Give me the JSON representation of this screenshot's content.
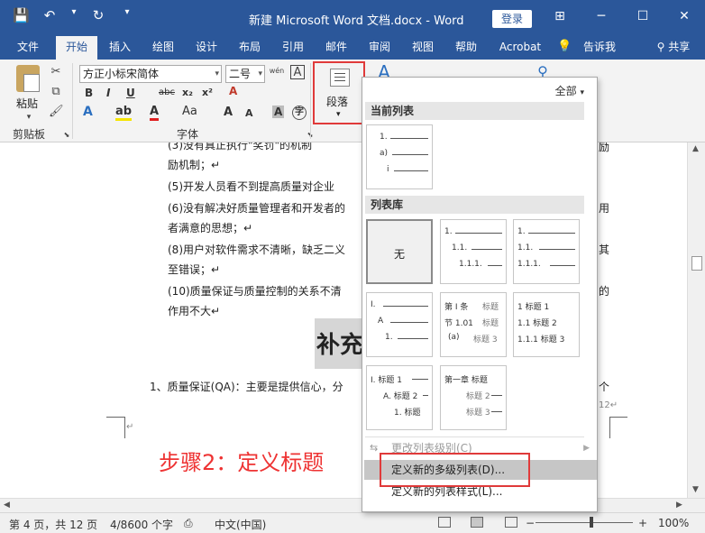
{
  "window": {
    "title": "新建 Microsoft Word 文档.docx - Word",
    "login": "登录",
    "qat": {
      "save": "💾",
      "undo": "↶",
      "undo_arrow": "▾",
      "redo": "↻",
      "customize": "▾"
    },
    "controls": {
      "ribbon_options": "⊞",
      "minimize": "─",
      "maximize": "☐",
      "close": "✕"
    }
  },
  "tabs": [
    "文件",
    "开始",
    "插入",
    "绘图",
    "设计",
    "布局",
    "引用",
    "邮件",
    "审阅",
    "视图",
    "帮助",
    "Acrobat",
    "告诉我",
    "共享"
  ],
  "active_tab": "开始",
  "tell_me_icon": "lightbulb-icon",
  "ribbon": {
    "clipboard": {
      "paste": "粘贴",
      "label": "剪贴板"
    },
    "font": {
      "family": "方正小标宋简体",
      "size": "二号",
      "label": "字体",
      "bold": "B",
      "italic": "I",
      "underline": "U",
      "strike": "abc",
      "sub": "x₂",
      "sup": "x²",
      "clear_format": "A",
      "grow": "A",
      "shrink": "A",
      "case": "Aa",
      "phonetic": "wén",
      "charborder": "A",
      "shading": "A"
    },
    "paragraph": {
      "label": "段落"
    }
  },
  "document": {
    "lines": [
      "(3)没有真正执行\"奖罚\"的机制",
      "励机制；↵",
      "(5)开发人员看不到提高质量对企业",
      "(6)没有解决好质量管理者和开发者的",
      "者满意的思想；↵",
      "(8)用户对软件需求不清晰，缺乏二义",
      "至错误；↵",
      "(10)质量保证与质量控制的关系不清",
      "作用不大↵"
    ],
    "right_fragments": [
      "励",
      "用",
      "其",
      "的"
    ],
    "heading": "补充",
    "qa_line": "1、质量保证(QA)：主要是提供信心，分",
    "qa_right": "个",
    "page_marker": "12↵",
    "step_note": "步骤2：定义标题"
  },
  "dropdown": {
    "filter": "全部",
    "current_section": "当前列表",
    "library_section": "列表库",
    "none_label": "无",
    "thumb_labels": {
      "current": [
        "1.",
        "a)",
        "i"
      ],
      "num_multi": [
        "1.",
        "1.1.",
        "1.1.1."
      ],
      "num_multi_dot": [
        "1.",
        "1.1.",
        "1.1.1."
      ],
      "roman": [
        "I.",
        "A",
        "1."
      ],
      "article": [
        "第 Ⅰ 条",
        "节 1.01",
        "(a)"
      ],
      "article_tags": [
        "标题",
        "标题",
        "标题 3"
      ],
      "heading_num": [
        "1 标题 1",
        "1.1 标题 2",
        "1.1.1 标题 3"
      ],
      "heading_roman": [
        "I. 标题 1",
        "A. 标题 2",
        "1. 标题"
      ],
      "chapter": [
        "第一章 标题",
        "标题 2",
        "标题 3"
      ]
    },
    "menu": [
      {
        "label": "更改列表级别(C)",
        "state": "disabled"
      },
      {
        "label": "定义新的多级列表(D)...",
        "state": "hover"
      },
      {
        "label": "定义新的列表样式(L)...",
        "state": "normal"
      }
    ]
  },
  "status": {
    "page": "第 4 页，共 12 页",
    "words": "4/8600 个字",
    "macro": "⎙",
    "lang": "中文(中国)",
    "zoom_out": "−",
    "zoom_in": "+",
    "zoom": "100%"
  }
}
